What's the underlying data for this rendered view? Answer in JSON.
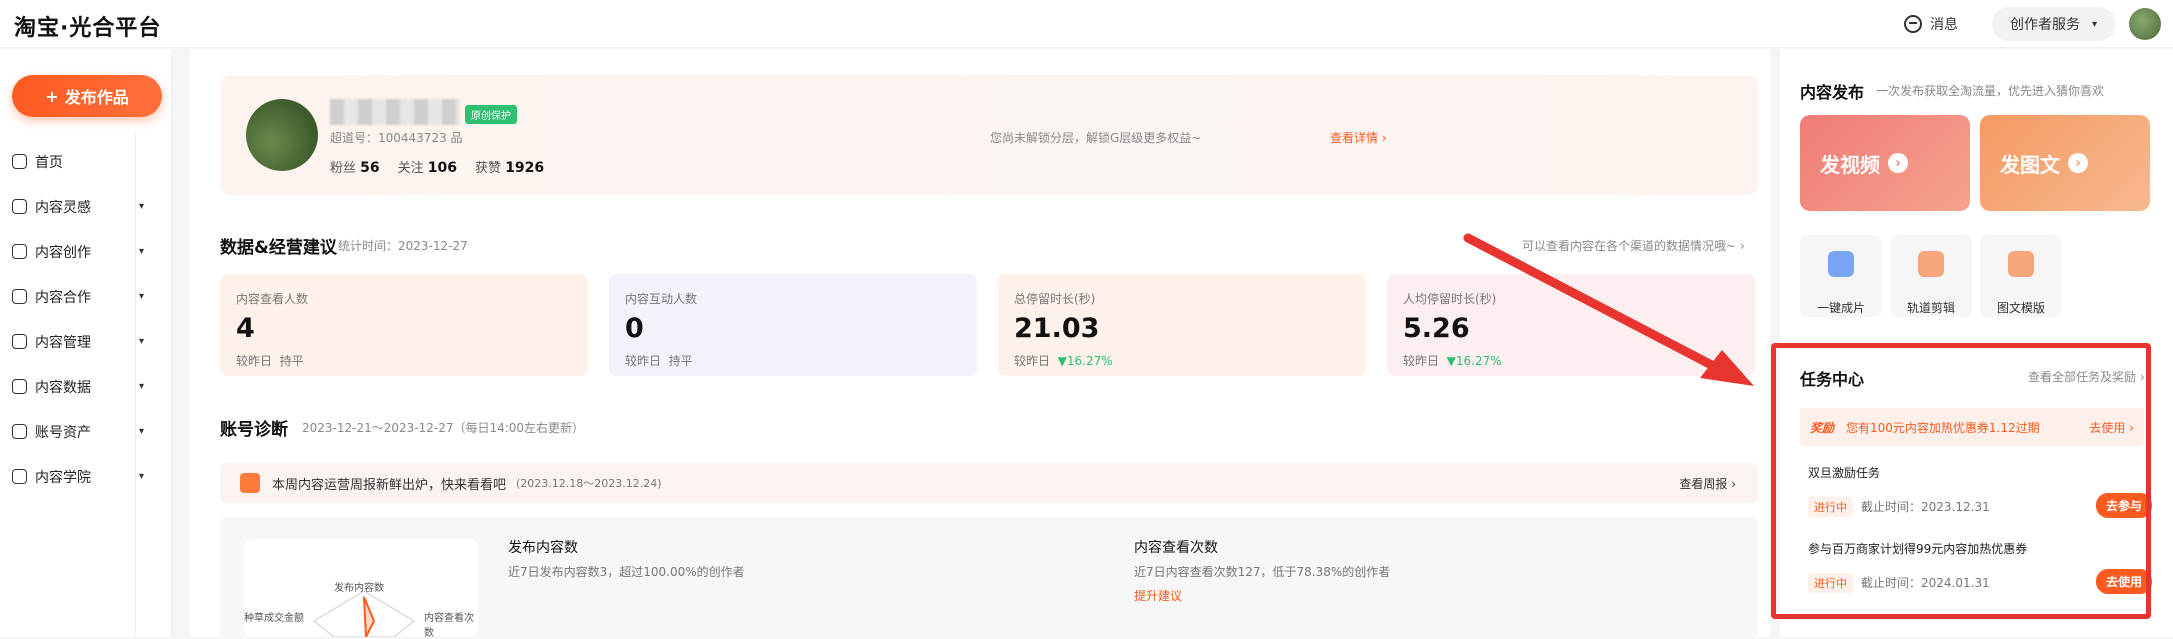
{
  "topbar": {
    "logo": "淘宝·光合平台",
    "messages": "消息",
    "creator_service": "创作者服务"
  },
  "sidebar": {
    "publish": "发布作品",
    "items": [
      {
        "label": "首页",
        "icon": "home-icon",
        "expand": false
      },
      {
        "label": "内容灵感",
        "icon": "bulb-icon",
        "expand": true
      },
      {
        "label": "内容创作",
        "icon": "edit-icon",
        "expand": true
      },
      {
        "label": "内容合作",
        "icon": "heart-icon",
        "expand": true
      },
      {
        "label": "内容管理",
        "icon": "folder-icon",
        "expand": true
      },
      {
        "label": "内容数据",
        "icon": "chart-icon",
        "expand": true
      },
      {
        "label": "账号资产",
        "icon": "wallet-icon",
        "expand": true
      },
      {
        "label": "内容学院",
        "icon": "school-icon",
        "expand": true
      }
    ]
  },
  "profile": {
    "badge": "原创保护",
    "id_text": "超道号：100443723 品",
    "fans_label": "粉丝",
    "fans": "56",
    "follow_label": "关注",
    "follow": "106",
    "likes_label": "获赞",
    "likes": "1926",
    "unlock_text": "您尚未解锁分层，解锁G层级更多权益~",
    "detail_link": "查看详情"
  },
  "data_section": {
    "title": "数据&经营建议",
    "stat_time": "统计时间：2023-12-27",
    "channel_link": "可以查看内容在各个渠道的数据情况哦~"
  },
  "metrics": [
    {
      "label": "内容查看人数",
      "value": "4",
      "compare": "较昨日",
      "change": "持平",
      "up": false,
      "bg": "#fdf1ea"
    },
    {
      "label": "内容互动人数",
      "value": "0",
      "compare": "较昨日",
      "change": "持平",
      "up": false,
      "bg": "#f1f3fb"
    },
    {
      "label": "总停留时长(秒)",
      "value": "21.03",
      "compare": "较昨日",
      "change": "▼16.27%",
      "up": true,
      "bg": "#fdf1ea"
    },
    {
      "label": "人均停留时长(秒)",
      "value": "5.26",
      "compare": "较昨日",
      "change": "▼16.27%",
      "up": true,
      "bg": "#fdeef0"
    }
  ],
  "diagnosis": {
    "title": "账号诊断",
    "range": "2023-12-21～2023-12-27（每日14:00左右更新）",
    "banner": "本周内容运营周报新鲜出炉，快来看看吧",
    "banner_range": "(2023.12.18～2023.12.24)",
    "weekly_link": "查看周报",
    "radar_labels": [
      "发布内容数",
      "内容查看次数",
      "种草成交金额"
    ],
    "publish_title": "发布内容数",
    "publish_desc": "近7日发布内容数3，超过100.00%的创作者",
    "views_title": "内容查看次数",
    "views_desc": "近7日内容查看次数127，低于78.38%的创作者",
    "improve": "提升建议"
  },
  "right": {
    "publish_title": "内容发布",
    "publish_sub": "一次发布获取全淘流量，优先进入猜你喜欢",
    "video": "发视频",
    "image_text": "发图文",
    "tools": [
      {
        "label": "一键成片",
        "icon": "clapper-icon"
      },
      {
        "label": "轨道剪辑",
        "icon": "signpost-icon"
      },
      {
        "label": "图文模版",
        "icon": "template-icon"
      }
    ]
  },
  "tasks": {
    "title": "任务中心",
    "all_link": "查看全部任务及奖励",
    "reward_tag": "奖励",
    "reward_text": "您有100元内容加热优惠券1.12过期",
    "reward_use": "去使用",
    "items": [
      {
        "name": "双旦激励任务",
        "status": "进行中",
        "deadline": "截止时间：2023.12.31",
        "action": "去参与"
      },
      {
        "name": "参与百万商家计划得99元内容加热优惠券",
        "status": "进行中",
        "deadline": "截止时间：2024.01.31",
        "action": "去使用"
      }
    ]
  },
  "colors": {
    "accent": "#ff5a1f",
    "up": "#2fbf71",
    "highlight": "#e8342e"
  }
}
